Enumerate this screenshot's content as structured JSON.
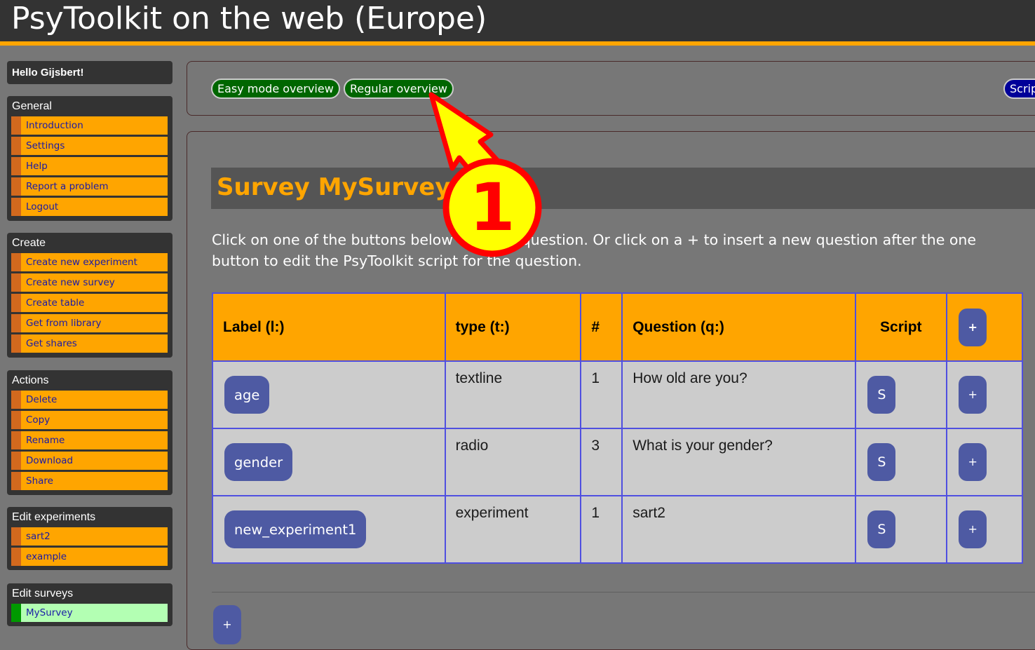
{
  "header": {
    "title": "PsyToolkit on the web (Europe)"
  },
  "sidebar": {
    "greeting": "Hello Gijsbert!",
    "sections": [
      {
        "title": "General",
        "items": [
          "Introduction",
          "Settings",
          "Help",
          "Report a problem",
          "Logout"
        ]
      },
      {
        "title": "Create",
        "items": [
          "Create new experiment",
          "Create new survey",
          "Create table",
          "Get from library",
          "Get shares"
        ]
      },
      {
        "title": "Actions",
        "items": [
          "Delete",
          "Copy",
          "Rename",
          "Download",
          "Share"
        ]
      },
      {
        "title": "Edit experiments",
        "items": [
          "sart2",
          "example"
        ]
      },
      {
        "title": "Edit surveys",
        "items": [
          "MySurvey"
        ],
        "active_item": "MySurvey"
      }
    ]
  },
  "toolbar": {
    "easy_mode_label": "Easy mode overview",
    "regular_label": "Regular overview",
    "script_label": "Script"
  },
  "main": {
    "survey_title": "Survey MySurvey",
    "instructions_line1": "Click on one of the buttons below to add a question. Or click on a + to insert a new question after the one",
    "instructions_line2": "button to edit the PsyToolkit script for the question."
  },
  "table": {
    "headers": {
      "label": "Label (l:)",
      "type": "type (t:)",
      "count": "#",
      "question": "Question (q:)",
      "script": "Script",
      "plus": "+"
    },
    "rows": [
      {
        "label": "age",
        "type": "textline",
        "count": "1",
        "question": "How old are you?",
        "script": "S",
        "plus": "+"
      },
      {
        "label": "gender",
        "type": "radio",
        "count": "3",
        "question": "What is your gender?",
        "script": "S",
        "plus": "+"
      },
      {
        "label": "new_experiment1",
        "type": "experiment",
        "count": "1",
        "question": "sart2",
        "script": "S",
        "plus": "+"
      }
    ]
  },
  "bottom": {
    "plus_label": "+"
  },
  "callout": {
    "number": "1"
  },
  "colors": {
    "header_bg": "#333333",
    "accent_orange": "#ffa500",
    "menu_marker": "#d2691e",
    "active_green": "#b3ffb3",
    "button_blue": "#4e5aa3",
    "pill_green": "#006600",
    "pill_blue": "#000099",
    "callout_yellow": "#ffff00",
    "callout_red": "#ff0000"
  }
}
